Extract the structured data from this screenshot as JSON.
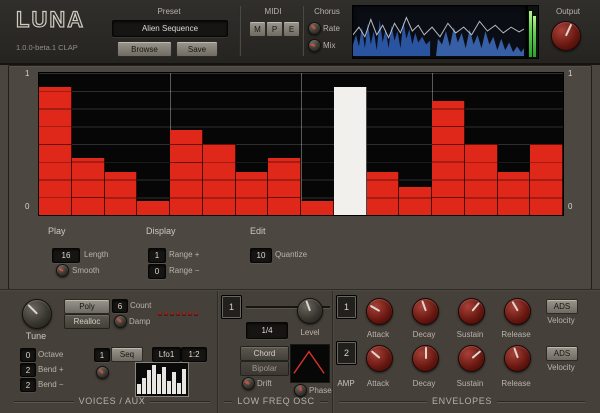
{
  "colors": {
    "accent_red": "#e0281a",
    "active_white": "#f1f0ed",
    "meter_green": "#4bd24b",
    "spectrum_blue": "#3f6fc0"
  },
  "header": {
    "logo": "LUNA",
    "version": "1.0.0-beta.1 CLAP",
    "preset": {
      "label": "Preset",
      "value": "Alien Sequence",
      "browse": "Browse",
      "save": "Save"
    },
    "midi": {
      "label": "MIDI",
      "buttons": [
        "M",
        "P",
        "E"
      ]
    },
    "chorus": {
      "label": "Chorus",
      "rate": "Rate",
      "mix": "Mix"
    },
    "output": {
      "label": "Output"
    }
  },
  "sequencer": {
    "scale_max": "1",
    "scale_min": "0",
    "steps": [
      0.9,
      0.4,
      0.3,
      0.1,
      0.6,
      0.5,
      0.3,
      0.4,
      0.1,
      0.9,
      0.3,
      0.2,
      0.8,
      0.5,
      0.3,
      0.5
    ],
    "active_step": 9,
    "controls": {
      "play_label": "Play",
      "display_label": "Display",
      "edit_label": "Edit",
      "length": {
        "value": "16",
        "label": "Length"
      },
      "smooth_label": "Smooth",
      "range_plus": {
        "value": "1",
        "label": "Range +"
      },
      "range_minus": {
        "value": "0",
        "label": "Range −"
      },
      "quantize": {
        "value": "10",
        "label": "Quantize"
      }
    }
  },
  "voices": {
    "title": "VOICES / AUX",
    "tune_label": "Tune",
    "poly": "Poly",
    "realloc": "Realloc",
    "count": {
      "value": "6",
      "label": "Count"
    },
    "led_count": 7,
    "damp_label": "Damp",
    "octave": {
      "value": "0",
      "label": "Octave"
    },
    "bend_up": {
      "value": "2",
      "label": "Bend +"
    },
    "bend_down": {
      "value": "2",
      "label": "Bend −"
    },
    "seq": {
      "value": "1",
      "label": "Seq"
    },
    "lfo_select": "Lfo1",
    "ratio": "1:2"
  },
  "lfo": {
    "title": "LOW FREQ OSC",
    "tab": "1",
    "rate": "1/4",
    "level_label": "Level",
    "chord": "Chord",
    "bipolar": "Bipolar",
    "drift_label": "Drift",
    "phase_label": "Phase"
  },
  "envelopes": {
    "title": "ENVELOPES",
    "env1": {
      "tab": "1",
      "knobs": [
        "Attack",
        "Decay",
        "Sustain",
        "Release"
      ],
      "ads": "ADS",
      "velocity": "Velocity"
    },
    "env2": {
      "tab": "2",
      "amp": "AMP",
      "knobs": [
        "Attack",
        "Decay",
        "Sustain",
        "Release"
      ],
      "ads": "ADS",
      "velocity": "Velocity"
    }
  }
}
